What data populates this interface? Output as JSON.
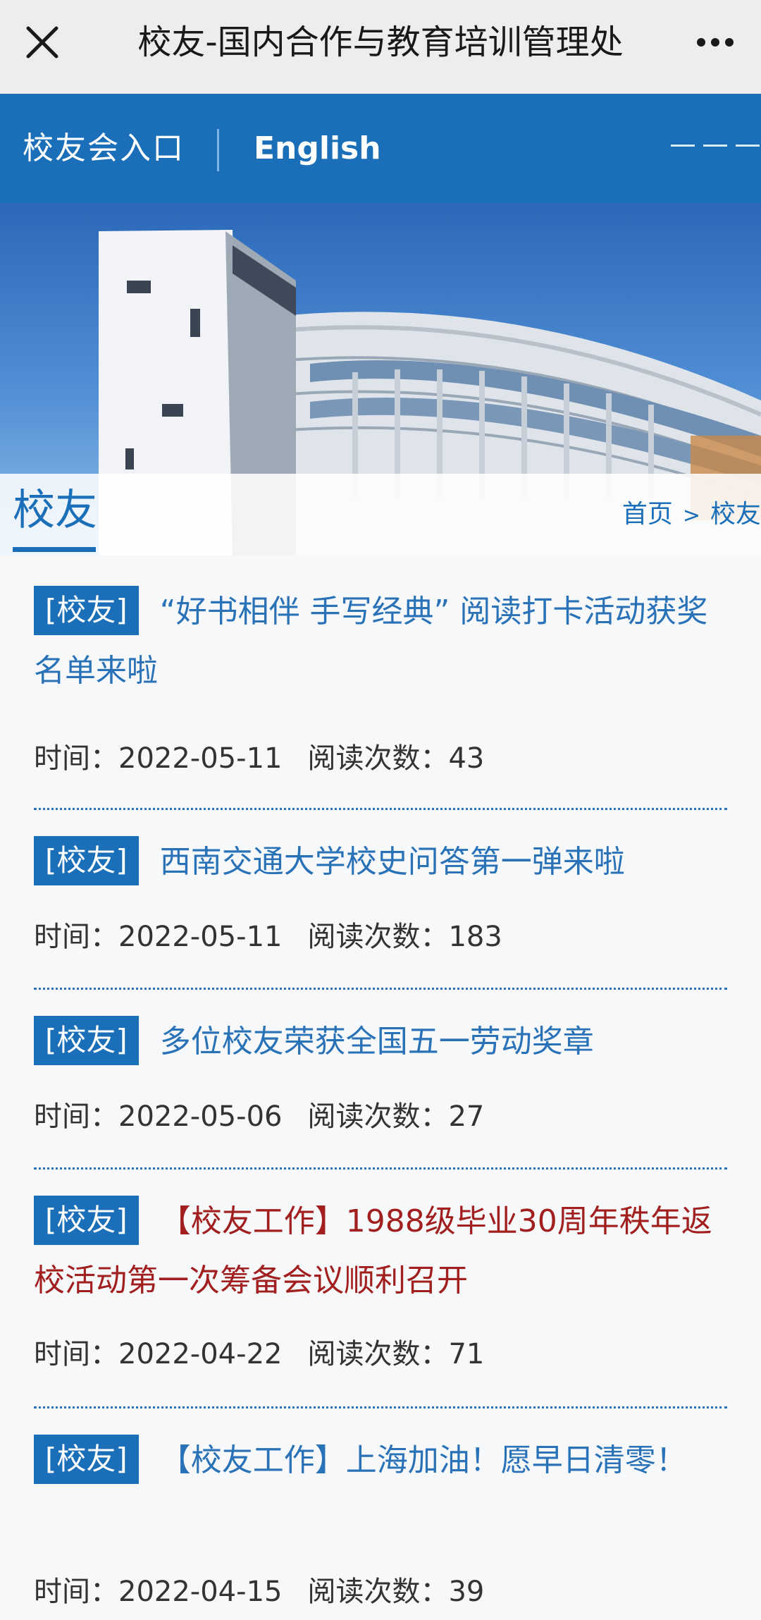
{
  "window": {
    "title": "校友-国内合作与教育培训管理处",
    "close_icon": "close-icon",
    "more_icon": "more-icon"
  },
  "nav": {
    "alumni_entry": "校友会入口",
    "english": "English",
    "menu_icon": "menu-icon"
  },
  "section": {
    "title": "校友",
    "breadcrumb": {
      "home": "首页",
      "separator": ">",
      "current": "校友"
    }
  },
  "news": {
    "time_label": "时间：",
    "views_label": "阅读次数：",
    "items": [
      {
        "tag": "[校友]",
        "title": "“好书相伴 手写经典” 阅读打卡活动获奖名单来啦",
        "date": "2022-05-11",
        "views": "43"
      },
      {
        "tag": "[校友]",
        "title": "西南交通大学校史问答第一弹来啦",
        "date": "2022-05-11",
        "views": "183"
      },
      {
        "tag": "[校友]",
        "title": "多位校友荣获全国五一劳动奖章",
        "date": "2022-05-06",
        "views": "27"
      },
      {
        "tag": "[校友]",
        "title": "【校友工作】1988级毕业30周年秩年返校活动第一次筹备会议顺利召开",
        "date": "2022-04-22",
        "views": "71"
      },
      {
        "tag": "[校友]",
        "title": "【校友工作】上海加油！愿早日清零！",
        "date": "2022-04-15",
        "views": "39"
      }
    ]
  },
  "colors": {
    "brand_blue": "#1a6fb8",
    "link_blue": "#2a72b7",
    "highlight_red": "#a11f1f",
    "topbar_bg": "#ededed"
  }
}
